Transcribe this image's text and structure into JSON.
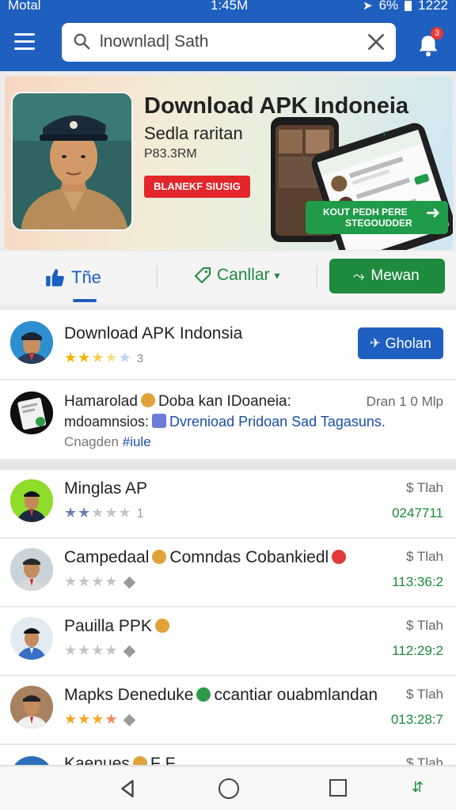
{
  "status_bar": {
    "carrier": "Motal",
    "time": "1:45M",
    "battery_pct": "6%",
    "right_text": "1222"
  },
  "search": {
    "query": "lnownlad| Sath",
    "notification_count": "3"
  },
  "banner": {
    "title": "Download APK Indoneia",
    "subtitle": "Sedla raritan",
    "price": "P83.3RM",
    "red_label": "BLANEKF SIUSIG",
    "cta_line1": "KOUT PEDH PERE",
    "cta_line2": "STEGOUDDER",
    "phone_badge": "r"
  },
  "tabs": {
    "trending": "Tñe",
    "category": "Canllar",
    "new": "Mewan"
  },
  "featured": {
    "title": "Download APK Indonsia",
    "rating_count": "3",
    "button_label": "Gholan"
  },
  "info_row": {
    "line1_a": "Hamarolad",
    "line1_b": "Doba kan IDoaneia:",
    "line2_a": "mdoamnsios:",
    "line2_b": "Dvrenioad Pridoan Sad Tagasuns.",
    "line3_a": "Cnagden",
    "line3_b": "#iule",
    "right_text": "Dran 1 0 Mlp"
  },
  "apps": [
    {
      "name": "Minglas AP",
      "size": "$ Tlah",
      "downloads": "0247711",
      "suffix": "1",
      "rating": 2
    },
    {
      "name_a": "Campedaal",
      "name_b": "Comndas Cobankiedl",
      "size": "$ Tlah",
      "downloads": "113:36:2",
      "rating": 0
    },
    {
      "name": "Pauilla PPK",
      "size": "$ Tlah",
      "downloads": "112:29:2",
      "rating": 0
    },
    {
      "name_a": "Mapks Deneduke",
      "name_b": "ccantiar ouabmlandan",
      "size": "$ Tlah",
      "downloads": "013:28:7",
      "rating": 3
    },
    {
      "name": "Kaenues",
      "suffix": "F F",
      "size": "$ Tlah"
    }
  ],
  "colors": {
    "primary": "#1e5fbf",
    "green": "#1e8a3d",
    "red": "#e3262a",
    "star": "#f5b400"
  }
}
